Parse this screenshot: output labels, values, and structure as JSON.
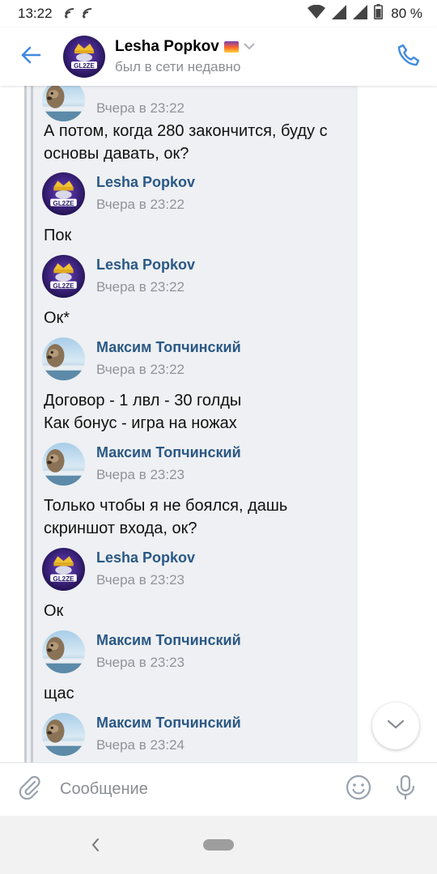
{
  "status_bar": {
    "time": "13:22",
    "battery": "80 %",
    "icons": [
      "wifi-calling-icon",
      "wifi-calling-icon",
      "wifi-icon",
      "signal-icon",
      "signal-icon",
      "battery-icon"
    ]
  },
  "header": {
    "name": "Lesha Popkov",
    "status": "был в сети недавно",
    "icons": [
      "back-arrow-icon",
      "chevron-down-icon",
      "phone-icon"
    ],
    "accent": "#2a5885"
  },
  "messages": [
    {
      "time": "Вчера в 23:22",
      "text": "А потом, когда 280 закончится, буду с основы давать, ок?"
    },
    {
      "author": "Lesha Popkov",
      "time": "Вчера в 23:22",
      "text": "Пок"
    },
    {
      "author": "Lesha Popkov",
      "time": "Вчера в 23:22",
      "text": "Ок*"
    },
    {
      "author": "Максим Топчинский",
      "time": "Вчера в 23:22",
      "text": "Договор - 1 лвл - 30 голды\nКак бонус - игра на ножах"
    },
    {
      "author": "Максим Топчинский",
      "time": "Вчера в 23:23",
      "text": "Только чтобы я не боялся, дашь скриншот входа, ок?"
    },
    {
      "author": "Lesha Popkov",
      "time": "Вчера в 23:23",
      "text": "Ок"
    },
    {
      "author": "Максим Топчинский",
      "time": "Вчера в 23:23",
      "text": "щас"
    },
    {
      "author": "Максим Топчинский",
      "time": "Вчера в 23:24"
    }
  ],
  "composer": {
    "placeholder": "Сообщение",
    "icons": [
      "attach-icon",
      "emoji-icon",
      "microphone-icon"
    ]
  },
  "nav": {
    "icons": [
      "nav-back-icon",
      "home-pill-icon"
    ]
  },
  "colors": {
    "link": "#2a5885",
    "forward_bg": "#eef0f3",
    "meta_gray": "#8f9399",
    "brand_blue": "#3f8ae0"
  }
}
